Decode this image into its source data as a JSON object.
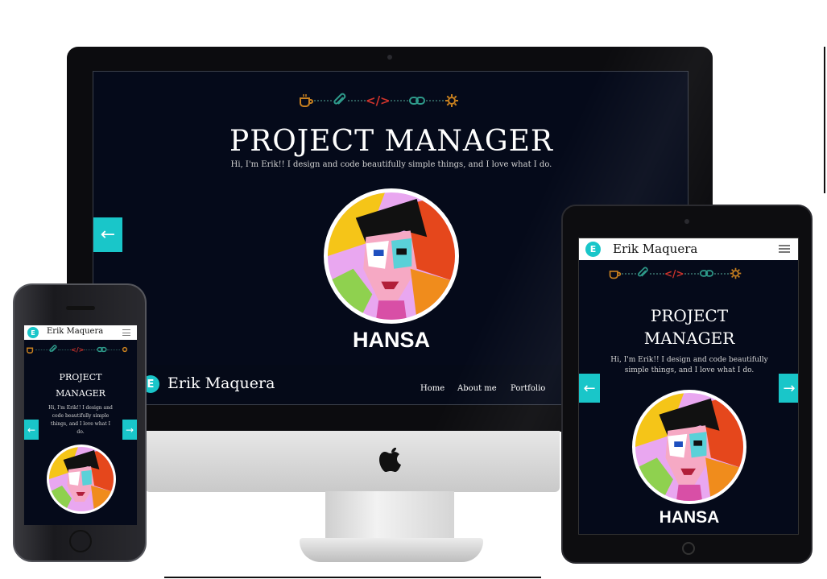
{
  "desktop": {
    "title": "PROJECT MANAGER",
    "subtitle": "Hi, I'm Erik!! I design and code beautifully simple things, and I love what I do.",
    "brand": "HANSA",
    "footer_name": "Erik Maquera",
    "nav": [
      "Home",
      "About me",
      "Portfolio"
    ],
    "prev_arrow": "←"
  },
  "tablet": {
    "header_name": "Erik Maquera",
    "title_line1": "PROJECT",
    "title_line2": "MANAGER",
    "subtitle_line1": "Hi, I'm Erik!! I design and code beautifully",
    "subtitle_line2": "simple things, and I love what I do.",
    "brand": "HANSA",
    "prev_arrow": "←",
    "next_arrow": "→"
  },
  "phone": {
    "header_name": "Erik Maquera",
    "title_line1": "PROJECT",
    "title_line2": "MANAGER",
    "subtitle_line1": "Hi, I'm Erik!! I design and",
    "subtitle_line2": "code beautifully simple",
    "subtitle_line3": "things, and I love what I",
    "subtitle_line4": "do.",
    "prev_arrow": "←",
    "next_arrow": "→"
  },
  "logo_letter": "E",
  "code_glyph": "</>",
  "icons": [
    "coffee-icon",
    "paperclip-icon",
    "code-icon",
    "link-icon",
    "gear-icon",
    "apple-logo-icon",
    "hamburger-menu-icon"
  ],
  "colors": {
    "screen_bg": "#050a1a",
    "accent": "#19c6c9",
    "coffee": "#c8801f",
    "paperclip": "#2e9a8a",
    "code": "#d0342c",
    "link": "#2e9a8a",
    "gear": "#c8801f"
  }
}
